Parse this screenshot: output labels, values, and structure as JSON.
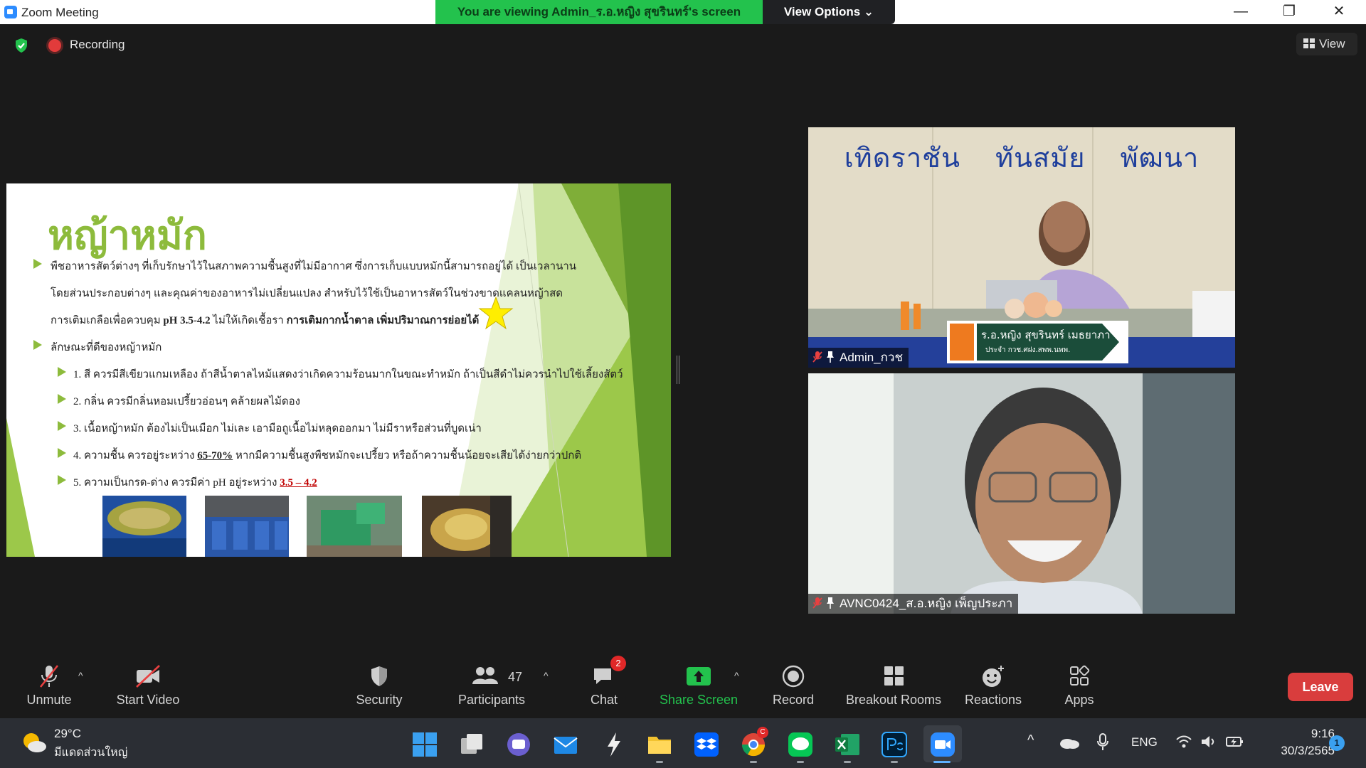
{
  "window": {
    "title": "Zoom Meeting"
  },
  "share_banner": {
    "text": "You are viewing Admin_ร.อ.หญิง สุขรินทร์'s screen",
    "view_options": "View Options"
  },
  "window_controls": {
    "minimize": "—",
    "maximize": "❐",
    "close": "✕"
  },
  "recording": {
    "label": "Recording"
  },
  "view_button": {
    "label": "View"
  },
  "slide": {
    "title": "หญ้าหมัก",
    "lines": [
      "พืชอาหารสัตว์ต่างๆ ที่เก็บรักษาไว้ในสภาพความชื้นสูงที่ไม่มีอากาศ ซึ่งการเก็บแบบหมักนี้สามารถอยู่ได้ เป็นเวลานาน",
      "โดยส่วนประกอบต่างๆ และคุณค่าของอาหารไม่เปลี่ยนแปลง สำหรับไว้ใช้เป็นอาหารสัตว์ในช่วงขาดแคลนหญ้าสด",
      "การเติมเกลือเพื่อควบคุม",
      "pH 3.5-4.2",
      "ไม่ให้เกิดเชื้อรา",
      "การเติมกากน้ำตาล เพิ่มปริมาณการย่อยได้",
      "ลักษณะที่ดีของหญ้าหมัก",
      "1. สี ควรมีสีเขียวแกมเหลือง ถ้าสีน้ำตาลไหม้แสดงว่าเกิดความร้อนมากในขณะทำหมัก ถ้าเป็นสีดำไม่ควรนำไปใช้เลี้ยงสัตว์",
      "2. กลิ่น ควรมีกลิ่นหอมเปรี้ยวอ่อนๆ คล้ายผลไม้ดอง",
      "3. เนื้อหญ้าหมัก ต้องไม่เป็นเมือก ไม่เละ เอามือถูเนื้อไม่หลุดออกมา ไม่มีราหรือส่วนที่บูดเน่า",
      "4. ความชื้น ควรอยู่ระหว่าง",
      "65-70%",
      "หากมีความชื้นสูงพืชหมักจะเปรี้ยว หรือถ้าความชื้นน้อยจะเสียได้ง่ายกว่าปกติ",
      "5. ความเป็นกรด-ด่าง ควรมีค่า pH อยู่ระหว่าง",
      "3.5 – 4.2"
    ]
  },
  "videos": [
    {
      "name": "Admin_กวช",
      "banner": "เทิดราชัน ทันสมัย พัฒนา",
      "lower_third_name": "ร.อ.หญิง สุขรินทร์ เมธยาภา",
      "lower_third_role": "ประจำ กวช.ศฝง.สพพ.นพพ."
    },
    {
      "name": "AVNC0424_ส.อ.หญิง เพ็ญประภา"
    }
  ],
  "toolbar": {
    "unmute": "Unmute",
    "start_video": "Start Video",
    "security": "Security",
    "participants": "Participants",
    "participants_count": "47",
    "chat": "Chat",
    "chat_badge": "2",
    "share_screen": "Share Screen",
    "record": "Record",
    "breakout_rooms": "Breakout Rooms",
    "reactions": "Reactions",
    "apps": "Apps",
    "leave": "Leave",
    "caret": "^"
  },
  "taskbar": {
    "weather_temp": "29°C",
    "weather_desc": "มีแดดส่วนใหญ่",
    "language": "ENG",
    "time": "9:16",
    "date": "30/3/2565",
    "notification_count": "1",
    "chrome_badge": "C",
    "caret": "^"
  },
  "colors": {
    "zoom_blue": "#2D8CFF",
    "share_green": "#23C24D",
    "leave_red": "#D93D3D",
    "slide_green": "#8DBB3C"
  }
}
